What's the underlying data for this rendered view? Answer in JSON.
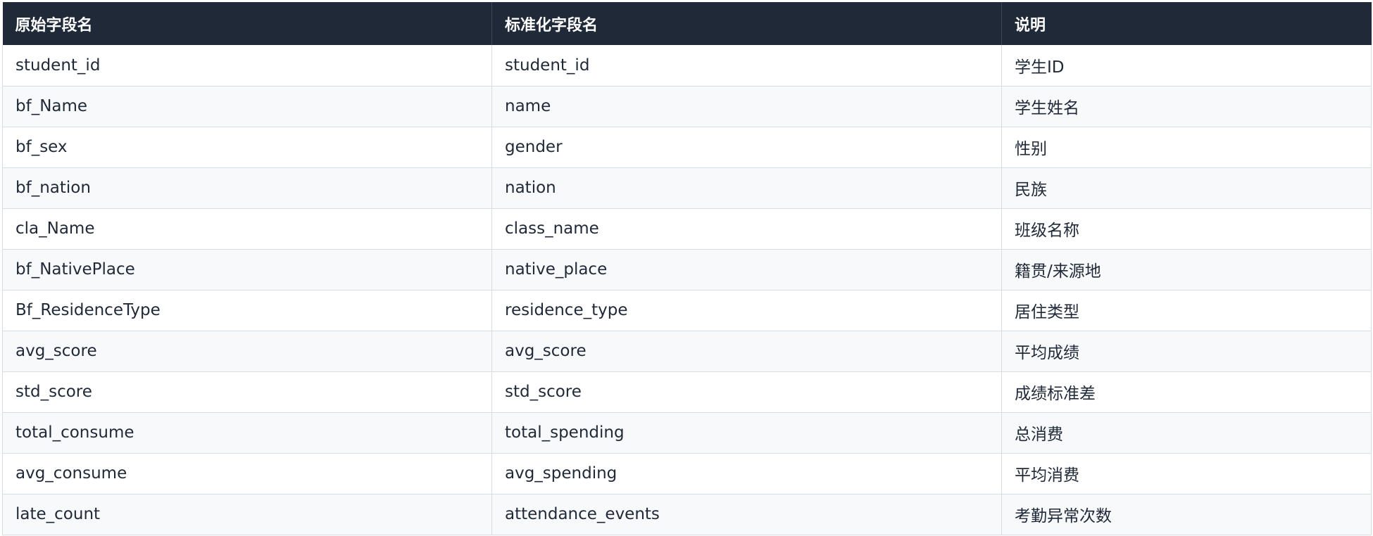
{
  "table": {
    "headers": [
      "原始字段名",
      "标准化字段名",
      "说明"
    ],
    "rows": [
      [
        "student_id",
        "student_id",
        "学生ID"
      ],
      [
        "bf_Name",
        "name",
        "学生姓名"
      ],
      [
        "bf_sex",
        "gender",
        "性别"
      ],
      [
        "bf_nation",
        "nation",
        "民族"
      ],
      [
        "cla_Name",
        "class_name",
        "班级名称"
      ],
      [
        "bf_NativePlace",
        "native_place",
        "籍贯/来源地"
      ],
      [
        "Bf_ResidenceType",
        "residence_type",
        "居住类型"
      ],
      [
        "avg_score",
        "avg_score",
        "平均成绩"
      ],
      [
        "std_score",
        "std_score",
        "成绩标准差"
      ],
      [
        "total_consume",
        "total_spending",
        "总消费"
      ],
      [
        "avg_consume",
        "avg_spending",
        "平均消费"
      ],
      [
        "late_count",
        "attendance_events",
        "考勤异常次数"
      ]
    ]
  },
  "colors": {
    "header_bg": "#1f2937",
    "header_text": "#ffffff",
    "row_alt_bg": "#f8f9fb",
    "border": "#d8dde4"
  }
}
